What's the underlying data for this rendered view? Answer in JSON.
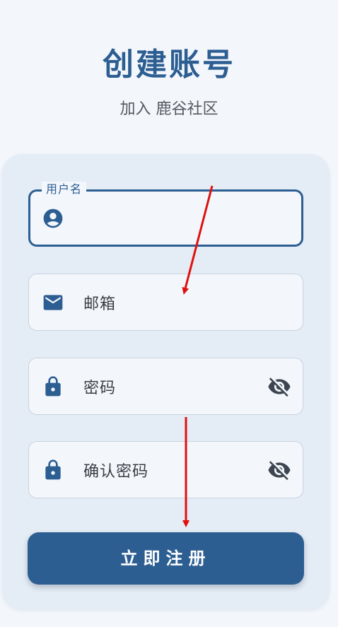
{
  "header": {
    "title": "创建账号",
    "subtitle": "加入 鹿谷社区"
  },
  "form": {
    "username": {
      "label": "用户名",
      "icon": "account-circle-icon",
      "value": ""
    },
    "email": {
      "placeholder": "邮箱",
      "icon": "mail-icon"
    },
    "password": {
      "placeholder": "密码",
      "icon": "lock-icon",
      "toggle_icon": "eye-off-icon"
    },
    "confirm_password": {
      "placeholder": "确认密码",
      "icon": "lock-icon",
      "toggle_icon": "eye-off-icon"
    },
    "submit_label": "立即注册"
  },
  "colors": {
    "primary": "#2d5e92",
    "background": "#f3f7fc",
    "card": "#e4ecf5",
    "annotation_arrow": "#e01010"
  }
}
